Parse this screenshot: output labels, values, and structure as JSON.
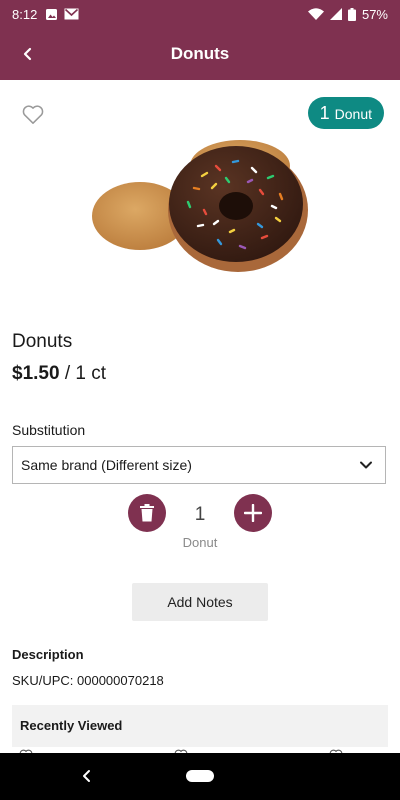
{
  "status_bar": {
    "time": "8:12",
    "battery": "57%"
  },
  "app_bar": {
    "title": "Donuts"
  },
  "cart_badge": {
    "count": "1",
    "unit": "Donut"
  },
  "product": {
    "name": "Donuts",
    "price": "$1.50",
    "price_unit": "/ 1 ct"
  },
  "substitution": {
    "label": "Substitution",
    "selected": "Same brand (Different size)"
  },
  "quantity": {
    "value": "1",
    "unit": "Donut"
  },
  "notes_button": "Add Notes",
  "description": {
    "heading": "Description",
    "sku": "SKU/UPC: 000000070218"
  },
  "recently_viewed": {
    "heading": "Recently Viewed"
  },
  "colors": {
    "primary": "#7f3150",
    "badge": "#0e8a83"
  }
}
